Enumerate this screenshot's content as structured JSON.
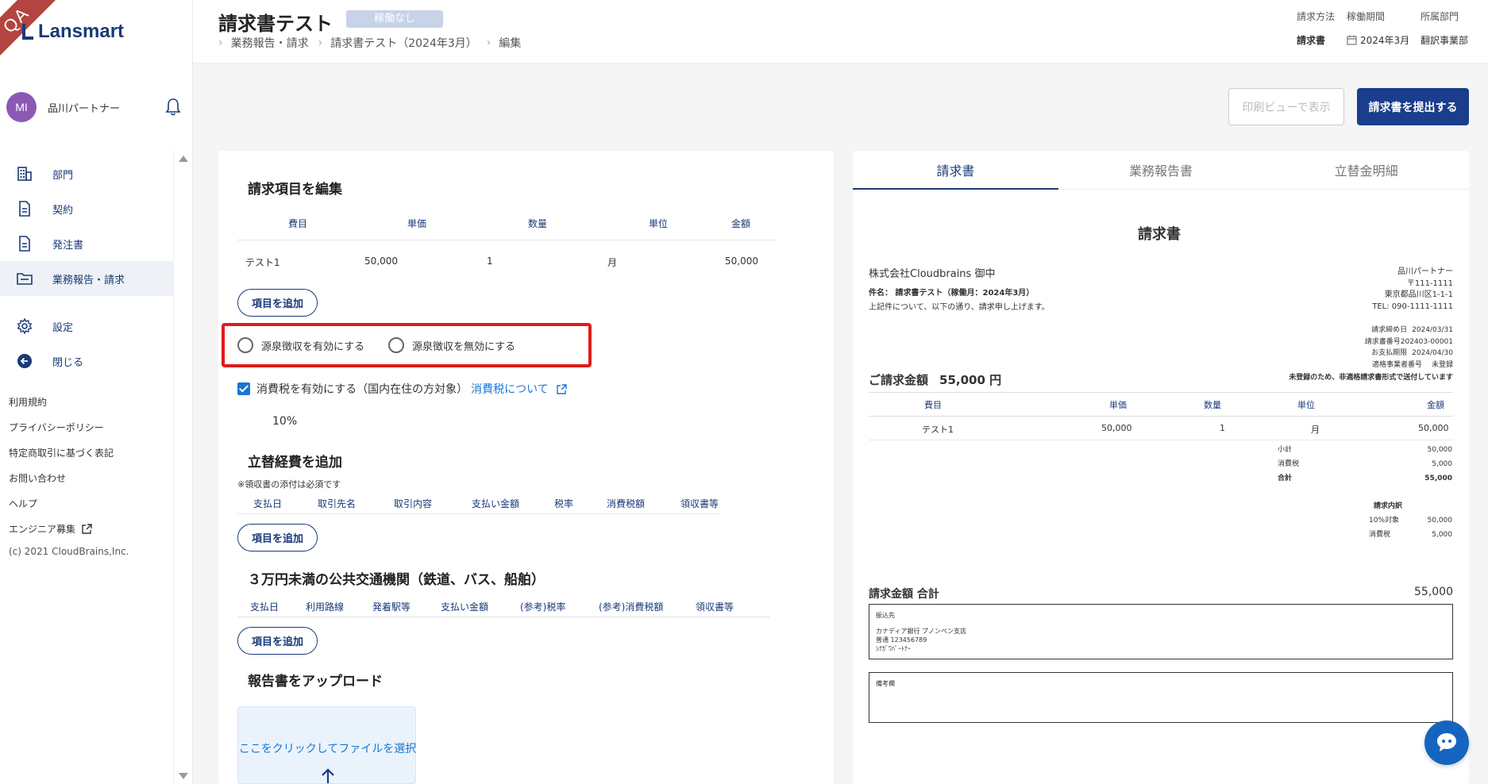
{
  "env_ribbon": "QA",
  "brand": {
    "name": "Lansmart"
  },
  "user": {
    "initials": "MI",
    "name": "品川パートナー",
    "avatar_color": "#8b59b5"
  },
  "sidebar": {
    "items": [
      {
        "label": "部門",
        "icon": "building-icon"
      },
      {
        "label": "契約",
        "icon": "document-icon"
      },
      {
        "label": "発注書",
        "icon": "document-icon"
      },
      {
        "label": "業務報告・請求",
        "icon": "folder-icon",
        "active": true
      },
      {
        "label": "設定",
        "icon": "gear-icon"
      },
      {
        "label": "閉じる",
        "icon": "arrow-left-circle-icon"
      }
    ],
    "links": [
      "利用規約",
      "プライバシーポリシー",
      "特定商取引に基づく表記",
      "お問い合わせ",
      "ヘルプ",
      "エンジニア募集"
    ],
    "copyright": "(c) 2021 CloudBrains,Inc."
  },
  "header": {
    "title": "請求書テスト",
    "status_badge": "稼働なし",
    "breadcrumb": [
      "業務報告・請求",
      "請求書テスト（2024年3月）",
      "編集"
    ],
    "meta": [
      {
        "label": "請求方法",
        "value": "請求書"
      },
      {
        "label": "稼働期間",
        "value": "2024年3月"
      },
      {
        "label": "所属部門",
        "value": "翻訳事業部"
      }
    ]
  },
  "actions": {
    "print_view": "印刷ビューで表示",
    "submit": "請求書を提出する"
  },
  "form": {
    "edit_title": "請求項目を編集",
    "columns": [
      "費目",
      "単価",
      "数量",
      "単位",
      "金額"
    ],
    "rows": [
      {
        "item": "テスト1",
        "unit_price": "50,000",
        "qty": "1",
        "unit": "月",
        "amount": "50,000"
      }
    ],
    "add_item": "項目を追加",
    "withholding_on": "源泉徴収を有効にする",
    "withholding_off": "源泉徴収を無効にする",
    "consumption_tax_label": "消費税を有効にする（国内在住の方対象）",
    "consumption_tax_link": "消費税について",
    "tax_rate": "10%",
    "expense_title": "立替経費を追加",
    "expense_note": "※領収書の添付は必須です",
    "expense_columns": [
      "支払日",
      "取引先名",
      "取引内容",
      "支払い金額",
      "税率",
      "消費税額",
      "領収書等"
    ],
    "transport_title": "３万円未満の公共交通機関（鉄道、バス、船舶）",
    "transport_columns": [
      "支払日",
      "利用路線",
      "発着駅等",
      "支払い金額",
      "(参考)税率",
      "(参考)消費税額",
      "領収書等"
    ],
    "upload_title": "報告書をアップロード",
    "upload_prompt": "ここをクリックしてファイルを選択"
  },
  "preview": {
    "tabs": [
      "請求書",
      "業務報告書",
      "立替金明細"
    ],
    "doc_title": "請求書",
    "client": "株式会社Cloudbrains 御中",
    "subject": "件名： 請求書テスト（稼働月：2024年3月）",
    "intro": "上記件について、以下の通り、請求申し上げます。",
    "issuer": [
      "品川パートナー",
      "〒111-1111",
      "東京都品川区1-1-1",
      "TEL: 090-1111-1111"
    ],
    "info_rows": [
      {
        "label": "請求締め日",
        "value": "2024/03/31"
      },
      {
        "label": "請求書番号",
        "value": "202403-00001"
      },
      {
        "label": "お支払期限",
        "value": "2024/04/30"
      },
      {
        "label": "適格事業者番号",
        "value": "未登録"
      }
    ],
    "unregistered_note": "未登録のため、非適格請求書形式で送付しています",
    "total_label": "ご請求金額",
    "total_value": "55,000 円",
    "columns": [
      "費目",
      "単価",
      "数量",
      "単位",
      "金額"
    ],
    "rows": [
      {
        "item": "テスト1",
        "unit_price": "50,000",
        "qty": "1",
        "unit": "月",
        "amount": "50,000"
      }
    ],
    "summary": [
      {
        "label": "小計",
        "value": "50,000"
      },
      {
        "label": "消費税",
        "value": "5,000"
      },
      {
        "label": "合計",
        "value": "55,000"
      }
    ],
    "breakdown_title": "請求内訳",
    "breakdown": [
      {
        "label": "10%対象",
        "value": "50,000"
      },
      {
        "label": "消費税",
        "value": "5,000"
      }
    ],
    "grand_total_label": "請求金額 合計",
    "grand_total_value": "55,000",
    "bank_label": "振込先",
    "bank_lines": [
      "カナディア銀行 プノンペン支店",
      "普通 123456789",
      "ｼﾅｶﾞﾜﾊﾟｰﾄﾅｰ"
    ],
    "notes_label": "備考欄"
  },
  "colors": {
    "primary": "#1a3d8c",
    "link": "#1976d2",
    "highlight": "#e01b1b",
    "badge": "#c7d3e6"
  }
}
